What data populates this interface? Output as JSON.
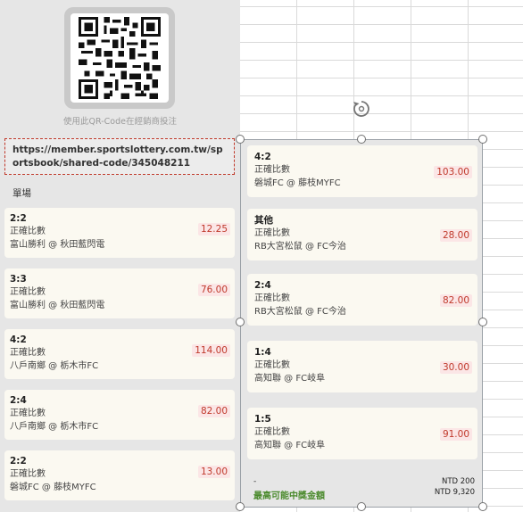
{
  "qr": {
    "caption": "使用此QR-Code在經銷商投注",
    "icon": "qr-code-icon"
  },
  "share_url": "https://member.sportslottery.com.tw/sportsbook/shared-code/345048211",
  "section_label": "單場",
  "left_bets": [
    {
      "score": "2:2",
      "market": "正確比數",
      "teams": "富山勝利 @ 秋田藍閃電",
      "odds": "12.25"
    },
    {
      "score": "3:3",
      "market": "正確比數",
      "teams": "富山勝利 @ 秋田藍閃電",
      "odds": "76.00"
    },
    {
      "score": "4:2",
      "market": "正確比數",
      "teams": "八戶南鄉 @ 栃木市FC",
      "odds": "114.00"
    },
    {
      "score": "2:4",
      "market": "正確比數",
      "teams": "八戶南鄉 @ 栃木市FC",
      "odds": "82.00"
    },
    {
      "score": "2:2",
      "market": "正確比數",
      "teams": "磐城FC @ 藤枝MYFC",
      "odds": "13.00"
    }
  ],
  "right_bets": [
    {
      "score": "4:2",
      "market": "正確比數",
      "teams": "磐城FC @ 藤枝MYFC",
      "odds": "103.00"
    },
    {
      "score": "其他",
      "market": "正確比數",
      "teams": "RB大宮松鼠 @ FC今治",
      "odds": "28.00"
    },
    {
      "score": "2:4",
      "market": "正確比數",
      "teams": "RB大宮松鼠 @ FC今治",
      "odds": "82.00"
    },
    {
      "score": "1:4",
      "market": "正確比數",
      "teams": "高知聯 @ FC岐阜",
      "odds": "30.00"
    },
    {
      "score": "1:5",
      "market": "正確比數",
      "teams": "高知聯 @ FC岐阜",
      "odds": "91.00"
    }
  ],
  "footer": {
    "dash": "-",
    "max_payout_label": "最高可能中獎金額",
    "stake": "NTD 200",
    "payout": "NTD 9,320"
  },
  "colors": {
    "odds_text": "#c0392b",
    "odds_bg": "#fbe6e6",
    "payout_label": "#4a8a2c",
    "card_bg": "#fbf9f1",
    "panel_bg": "#e6e6e6"
  }
}
